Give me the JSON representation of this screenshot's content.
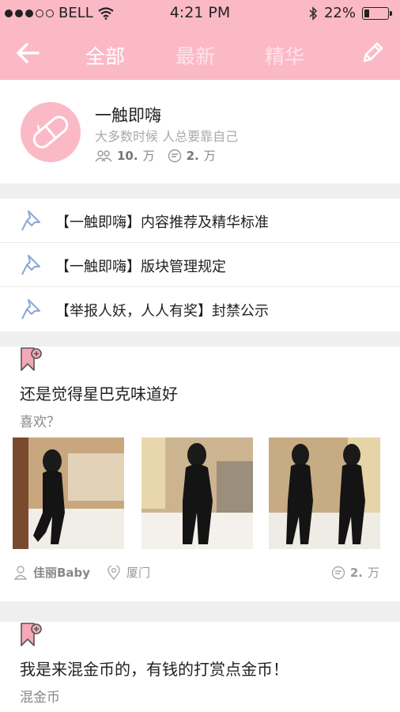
{
  "status_bar": {
    "carrier": "BELL",
    "time": "4:21 PM",
    "battery": "22%",
    "battery_level": 0.22,
    "signal_bars_filled": 3,
    "signal_bars_total": 5
  },
  "nav": {
    "tabs": [
      {
        "label": "全部",
        "active": true
      },
      {
        "label": "最新",
        "active": false
      },
      {
        "label": "精华",
        "active": false
      }
    ]
  },
  "group": {
    "name": "一触即嗨",
    "description": "大多数时候 人总要靠自己",
    "members": "10.",
    "members_unit": "万",
    "posts": "2.",
    "posts_unit": "万"
  },
  "pinned": [
    {
      "text": "【一触即嗨】内容推荐及精华标准"
    },
    {
      "text": "【一触即嗨】版块管理规定"
    },
    {
      "text": "【举报人妖，人人有奖】封禁公示"
    }
  ],
  "posts": [
    {
      "title": "还是觉得星巴克味道好",
      "excerpt": "喜欢？",
      "author": "佳丽Baby",
      "location": "厦门",
      "comments": "2.",
      "comments_unit": "万",
      "photos": [
        "photo-1",
        "photo-2",
        "photo-3"
      ]
    },
    {
      "title": "我是来混金币的，有钱的打赏点金币！",
      "excerpt": "混金币"
    }
  ],
  "colors": {
    "brand_pink": "#fbb9c6",
    "tab_inactive": "#fde4ea",
    "pin_icon": "#8aa6d6",
    "bookmark_fill": "#f7a8b8"
  }
}
